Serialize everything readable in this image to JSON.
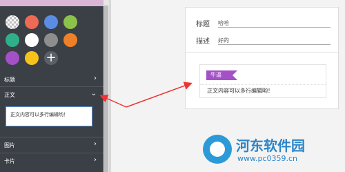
{
  "swatches": [
    {
      "name": "transparent",
      "color": "transparent"
    },
    {
      "name": "red",
      "color": "#ef6a55"
    },
    {
      "name": "blue",
      "color": "#5b8de5"
    },
    {
      "name": "green",
      "color": "#8bc34a"
    },
    {
      "name": "teal",
      "color": "#2fb08a"
    },
    {
      "name": "white",
      "color": "#ffffff"
    },
    {
      "name": "gray",
      "color": "#8e8e8e"
    },
    {
      "name": "orange",
      "color": "#f08027"
    },
    {
      "name": "purple",
      "color": "#a451c7"
    },
    {
      "name": "yellow",
      "color": "#f7c31b"
    },
    {
      "name": "add",
      "icon": "plus-icon",
      "label": "+"
    }
  ],
  "sidebar": {
    "sections": [
      {
        "key": "title",
        "label": "标题",
        "chevron": "›"
      },
      {
        "key": "body",
        "label": "正文",
        "chevron": "⌄",
        "expanded": true
      },
      {
        "key": "image",
        "label": "图片",
        "chevron": "›"
      },
      {
        "key": "card",
        "label": "卡片",
        "chevron": "›"
      }
    ],
    "body_editor_value": "正文内容可以多行编辑哟！"
  },
  "preview": {
    "title_label": "标题",
    "title_value": "哈哈",
    "desc_label": "描述",
    "desc_value": "好的",
    "tag": "牛逼",
    "body": "正文内容可以多行编辑哟！"
  },
  "watermark": {
    "name": "河东软件园",
    "url": "www.pc0359.cn"
  }
}
